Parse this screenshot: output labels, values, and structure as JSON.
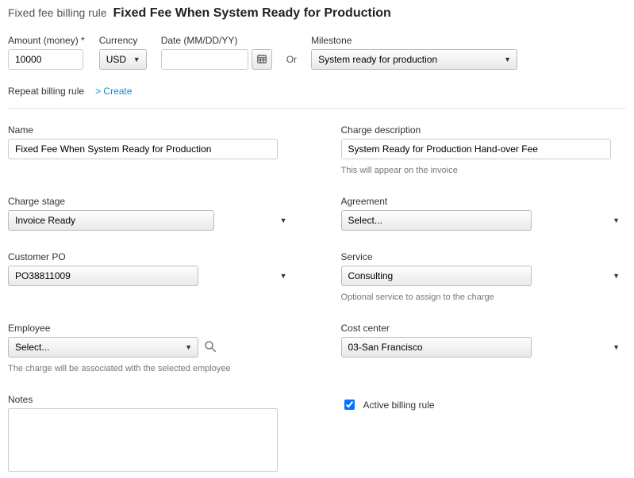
{
  "header": {
    "prefix": "Fixed fee billing rule",
    "title": "Fixed Fee When System Ready for Production"
  },
  "amount": {
    "label": "Amount (money)",
    "value": "10000"
  },
  "currency": {
    "label": "Currency",
    "value": "USD"
  },
  "date": {
    "label": "Date (MM/DD/YY)",
    "value": ""
  },
  "or_text": "Or",
  "milestone": {
    "label": "Milestone",
    "value": "System ready for production"
  },
  "repeat": {
    "label": "Repeat billing rule",
    "create": "Create"
  },
  "name": {
    "label": "Name",
    "value": "Fixed Fee When System Ready for Production"
  },
  "charge_description": {
    "label": "Charge description",
    "value": "System Ready for Production Hand-over Fee",
    "help": "This will appear on the invoice"
  },
  "charge_stage": {
    "label": "Charge stage",
    "value": "Invoice Ready"
  },
  "agreement": {
    "label": "Agreement",
    "value": "Select..."
  },
  "customer_po": {
    "label": "Customer PO",
    "value": "PO38811009"
  },
  "service": {
    "label": "Service",
    "value": "Consulting",
    "help": "Optional service to assign to the charge"
  },
  "employee": {
    "label": "Employee",
    "value": "Select...",
    "help": "The charge will be associated with the selected employee"
  },
  "cost_center": {
    "label": "Cost center",
    "value": "03-San Francisco"
  },
  "notes": {
    "label": "Notes",
    "value": ""
  },
  "active": {
    "label": "Active billing rule",
    "checked": true
  }
}
